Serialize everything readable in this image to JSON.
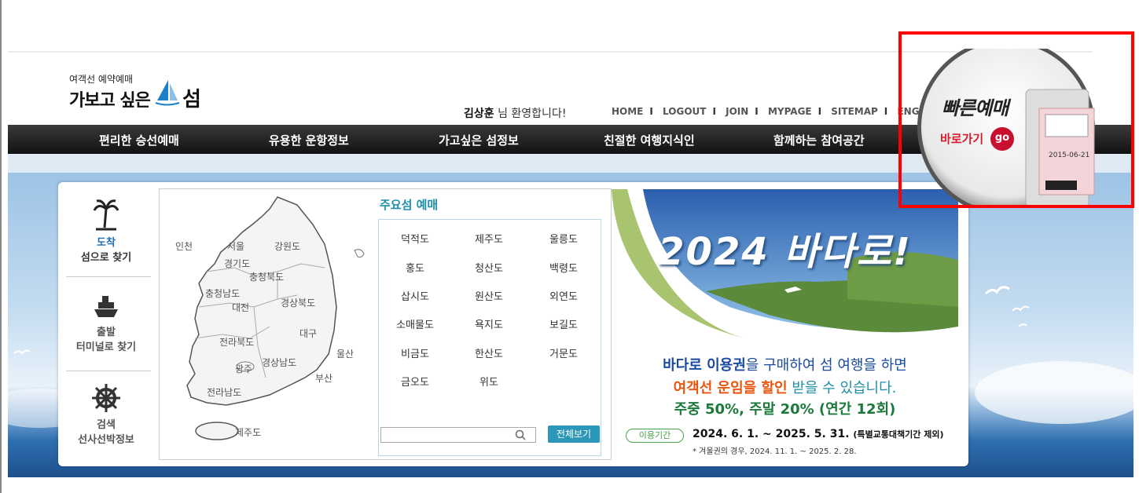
{
  "logo": {
    "small": "여객선 예약예매",
    "main": "가보고 싶은",
    "last": "섬"
  },
  "welcome": {
    "name": "김상훈",
    "suffix": " 님 환영합니다!"
  },
  "util": [
    "HOME",
    "LOGOUT",
    "JOIN",
    "MYPAGE",
    "SITEMAP",
    "ENGLISH"
  ],
  "gnb": [
    "편리한 승선예매",
    "유용한 운항정보",
    "가고싶은 섬정보",
    "친절한 여행지식인",
    "함께하는 참여공간"
  ],
  "side": [
    {
      "l1": "도착",
      "l2": "섬으로 찾기"
    },
    {
      "l1": "출발",
      "l2": "터미널로 찾기"
    },
    {
      "l1": "검색",
      "l2": "선사선박정보"
    }
  ],
  "regions": [
    "인천",
    "서울",
    "경기도",
    "강원도",
    "충청북도",
    "충청남도",
    "대전",
    "경상북도",
    "대구",
    "전라북도",
    "경상남도",
    "울산",
    "광주",
    "부산",
    "전라남도",
    "제주도"
  ],
  "islands": {
    "title": "주요섬 예매",
    "items": [
      "덕적도",
      "제주도",
      "울릉도",
      "홍도",
      "청산도",
      "백령도",
      "삽시도",
      "원산도",
      "외연도",
      "소매물도",
      "욕지도",
      "보길도",
      "비금도",
      "한산도",
      "거문도",
      "금오도",
      "위도"
    ],
    "view_all": "전체보기"
  },
  "promo": {
    "headline": "2024 바다로!",
    "line1a": "바다로 이용권",
    "line1b": "을 구매하여 섬 여행을 하면",
    "line2a": "여객선 운임을 할인",
    "line2b": " 받을 수 있습니다.",
    "line3": "주중 50%, 주말 20% (연간 12회)",
    "period_label": "이용기간",
    "period": "2024. 6. 1. ~ 2025. 5. 31.",
    "period_note": "(특별교통대책기간 제외)",
    "winter": "* 겨울권의 경우, 2024. 11. 1. ~ 2025. 2. 28."
  },
  "quick": {
    "title": "빠른예매",
    "go_label": "바로가기",
    "go": "go",
    "ticket_date": "2015-06-21"
  },
  "colors": {
    "accent": "#1e8fa8",
    "highlight": "#ff0000",
    "promo_blue": "#1a4aa0",
    "promo_orange": "#e8560f",
    "promo_green": "#1b7a3a"
  }
}
